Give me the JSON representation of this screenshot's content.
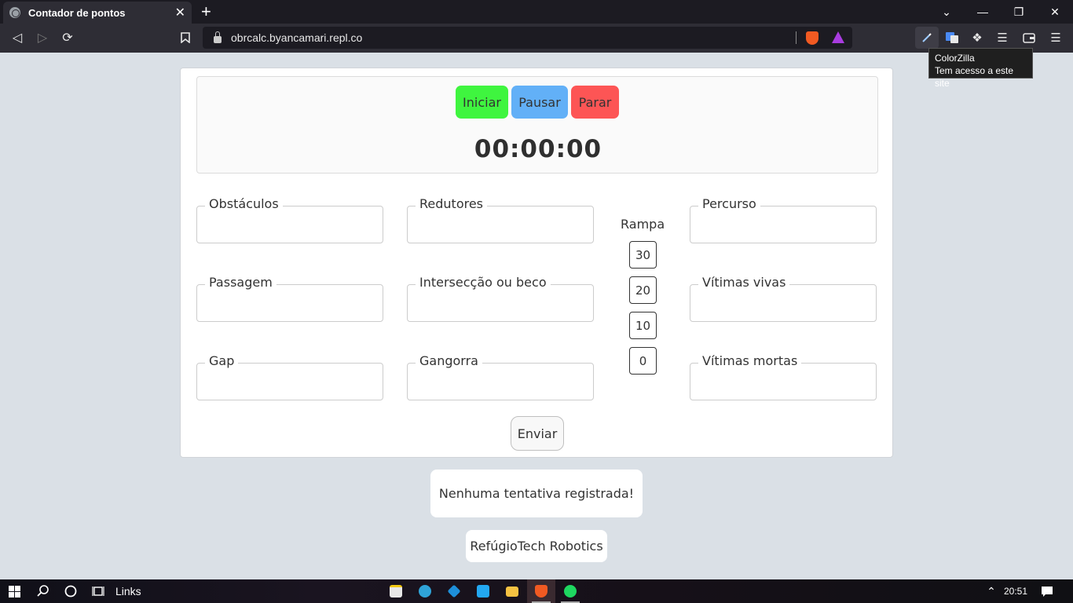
{
  "browser": {
    "tab_title": "Contador de pontos",
    "tab_close": "✕",
    "new_tab": "+",
    "url": "obrcalc.byancamari.repl.co",
    "tooltip_title": "ColorZilla",
    "tooltip_text": "Tem acesso a este site"
  },
  "timer": {
    "start_label": "Iniciar",
    "pause_label": "Pausar",
    "stop_label": "Parar",
    "display": "00:00:00",
    "colors": {
      "start": "#3ff53f",
      "pause": "#62b0f7",
      "stop": "#fd5555"
    }
  },
  "fields": {
    "obstaculos": {
      "label": "Obstáculos",
      "value": ""
    },
    "redutores": {
      "label": "Redutores",
      "value": ""
    },
    "percurso": {
      "label": "Percurso",
      "value": ""
    },
    "passagem": {
      "label": "Passagem",
      "value": ""
    },
    "interseccao": {
      "label": "Intersecção ou beco",
      "value": ""
    },
    "vitimas_vivas": {
      "label": "Vítimas vivas",
      "value": ""
    },
    "gap": {
      "label": "Gap",
      "value": ""
    },
    "gangorra": {
      "label": "Gangorra",
      "value": ""
    },
    "vitimas_mortas": {
      "label": "Vítimas mortas",
      "value": ""
    }
  },
  "rampa": {
    "label": "Rampa",
    "options": [
      "30",
      "20",
      "10",
      "0"
    ]
  },
  "submit_label": "Enviar",
  "status_message": "Nenhuma tentativa registrada!",
  "credit": "RefúgioTech Robotics",
  "taskbar": {
    "links_label": "Links",
    "time": "20:51"
  }
}
